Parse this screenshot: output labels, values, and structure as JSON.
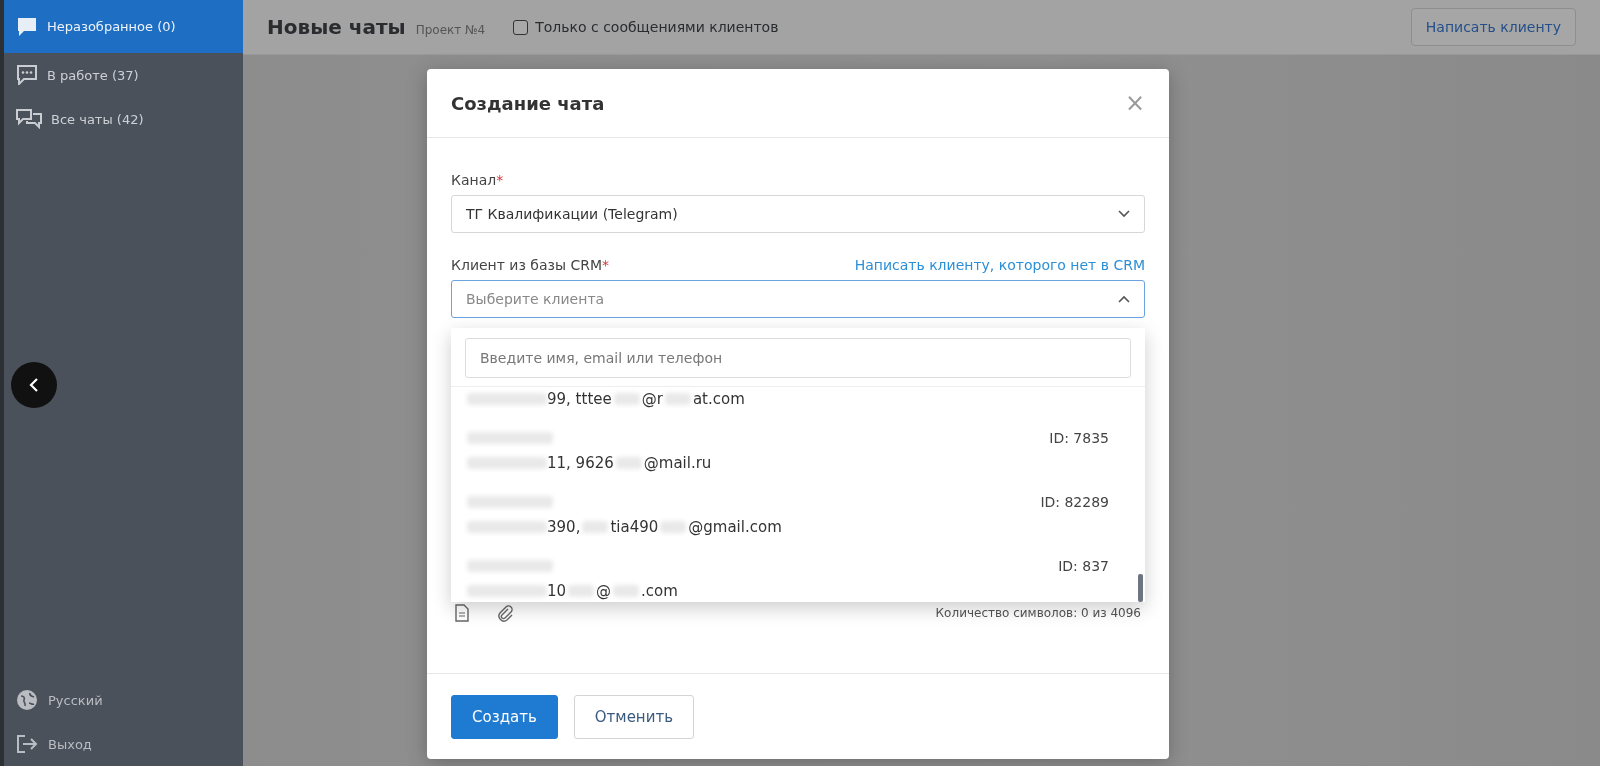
{
  "sidebar": {
    "items": [
      {
        "label": "Неразобранное (0)",
        "selected": true
      },
      {
        "label": "В работе (37)",
        "selected": false
      },
      {
        "label": "Все чаты (42)",
        "selected": false
      }
    ],
    "footer": [
      {
        "label": "Русский"
      },
      {
        "label": "Выход"
      }
    ]
  },
  "header": {
    "title": "Новые чаты",
    "project": "Проект №4",
    "filter": {
      "label": "Только с сообщениями клиентов",
      "checked": false
    },
    "button": "Написать клиенту"
  },
  "modal": {
    "title": "Создание чата",
    "close": "×",
    "channel": {
      "label": "Канал",
      "mark": "*",
      "value": "ТГ Квалификации (Telegram)"
    },
    "client": {
      "label": "Клиент из базы CRM",
      "mark": "*",
      "link": "Написать клиенту, которого нет в CRM",
      "placeholder": "Выберите клиента",
      "expanded": true
    },
    "dropdown": {
      "search_placeholder": "Введите имя, email или телефон",
      "rows": [
        {
          "segments": [
            "99, tttee",
            "@r",
            "at.com"
          ]
        },
        {
          "id": "ID: 7835",
          "segments": [
            "11, 9626",
            "@mail.ru"
          ]
        },
        {
          "id": "ID: 82289",
          "segments": [
            "390,",
            "tia490",
            "@gmail.com"
          ]
        },
        {
          "id": "ID: 837",
          "segments": [
            "10",
            "@",
            ".com"
          ]
        }
      ]
    },
    "char_count": "Количество символов: 0 из 4096",
    "buttons": [
      {
        "label": "Создать",
        "kind": "primary"
      },
      {
        "label": "Отменить",
        "kind": "secondary"
      }
    ]
  }
}
